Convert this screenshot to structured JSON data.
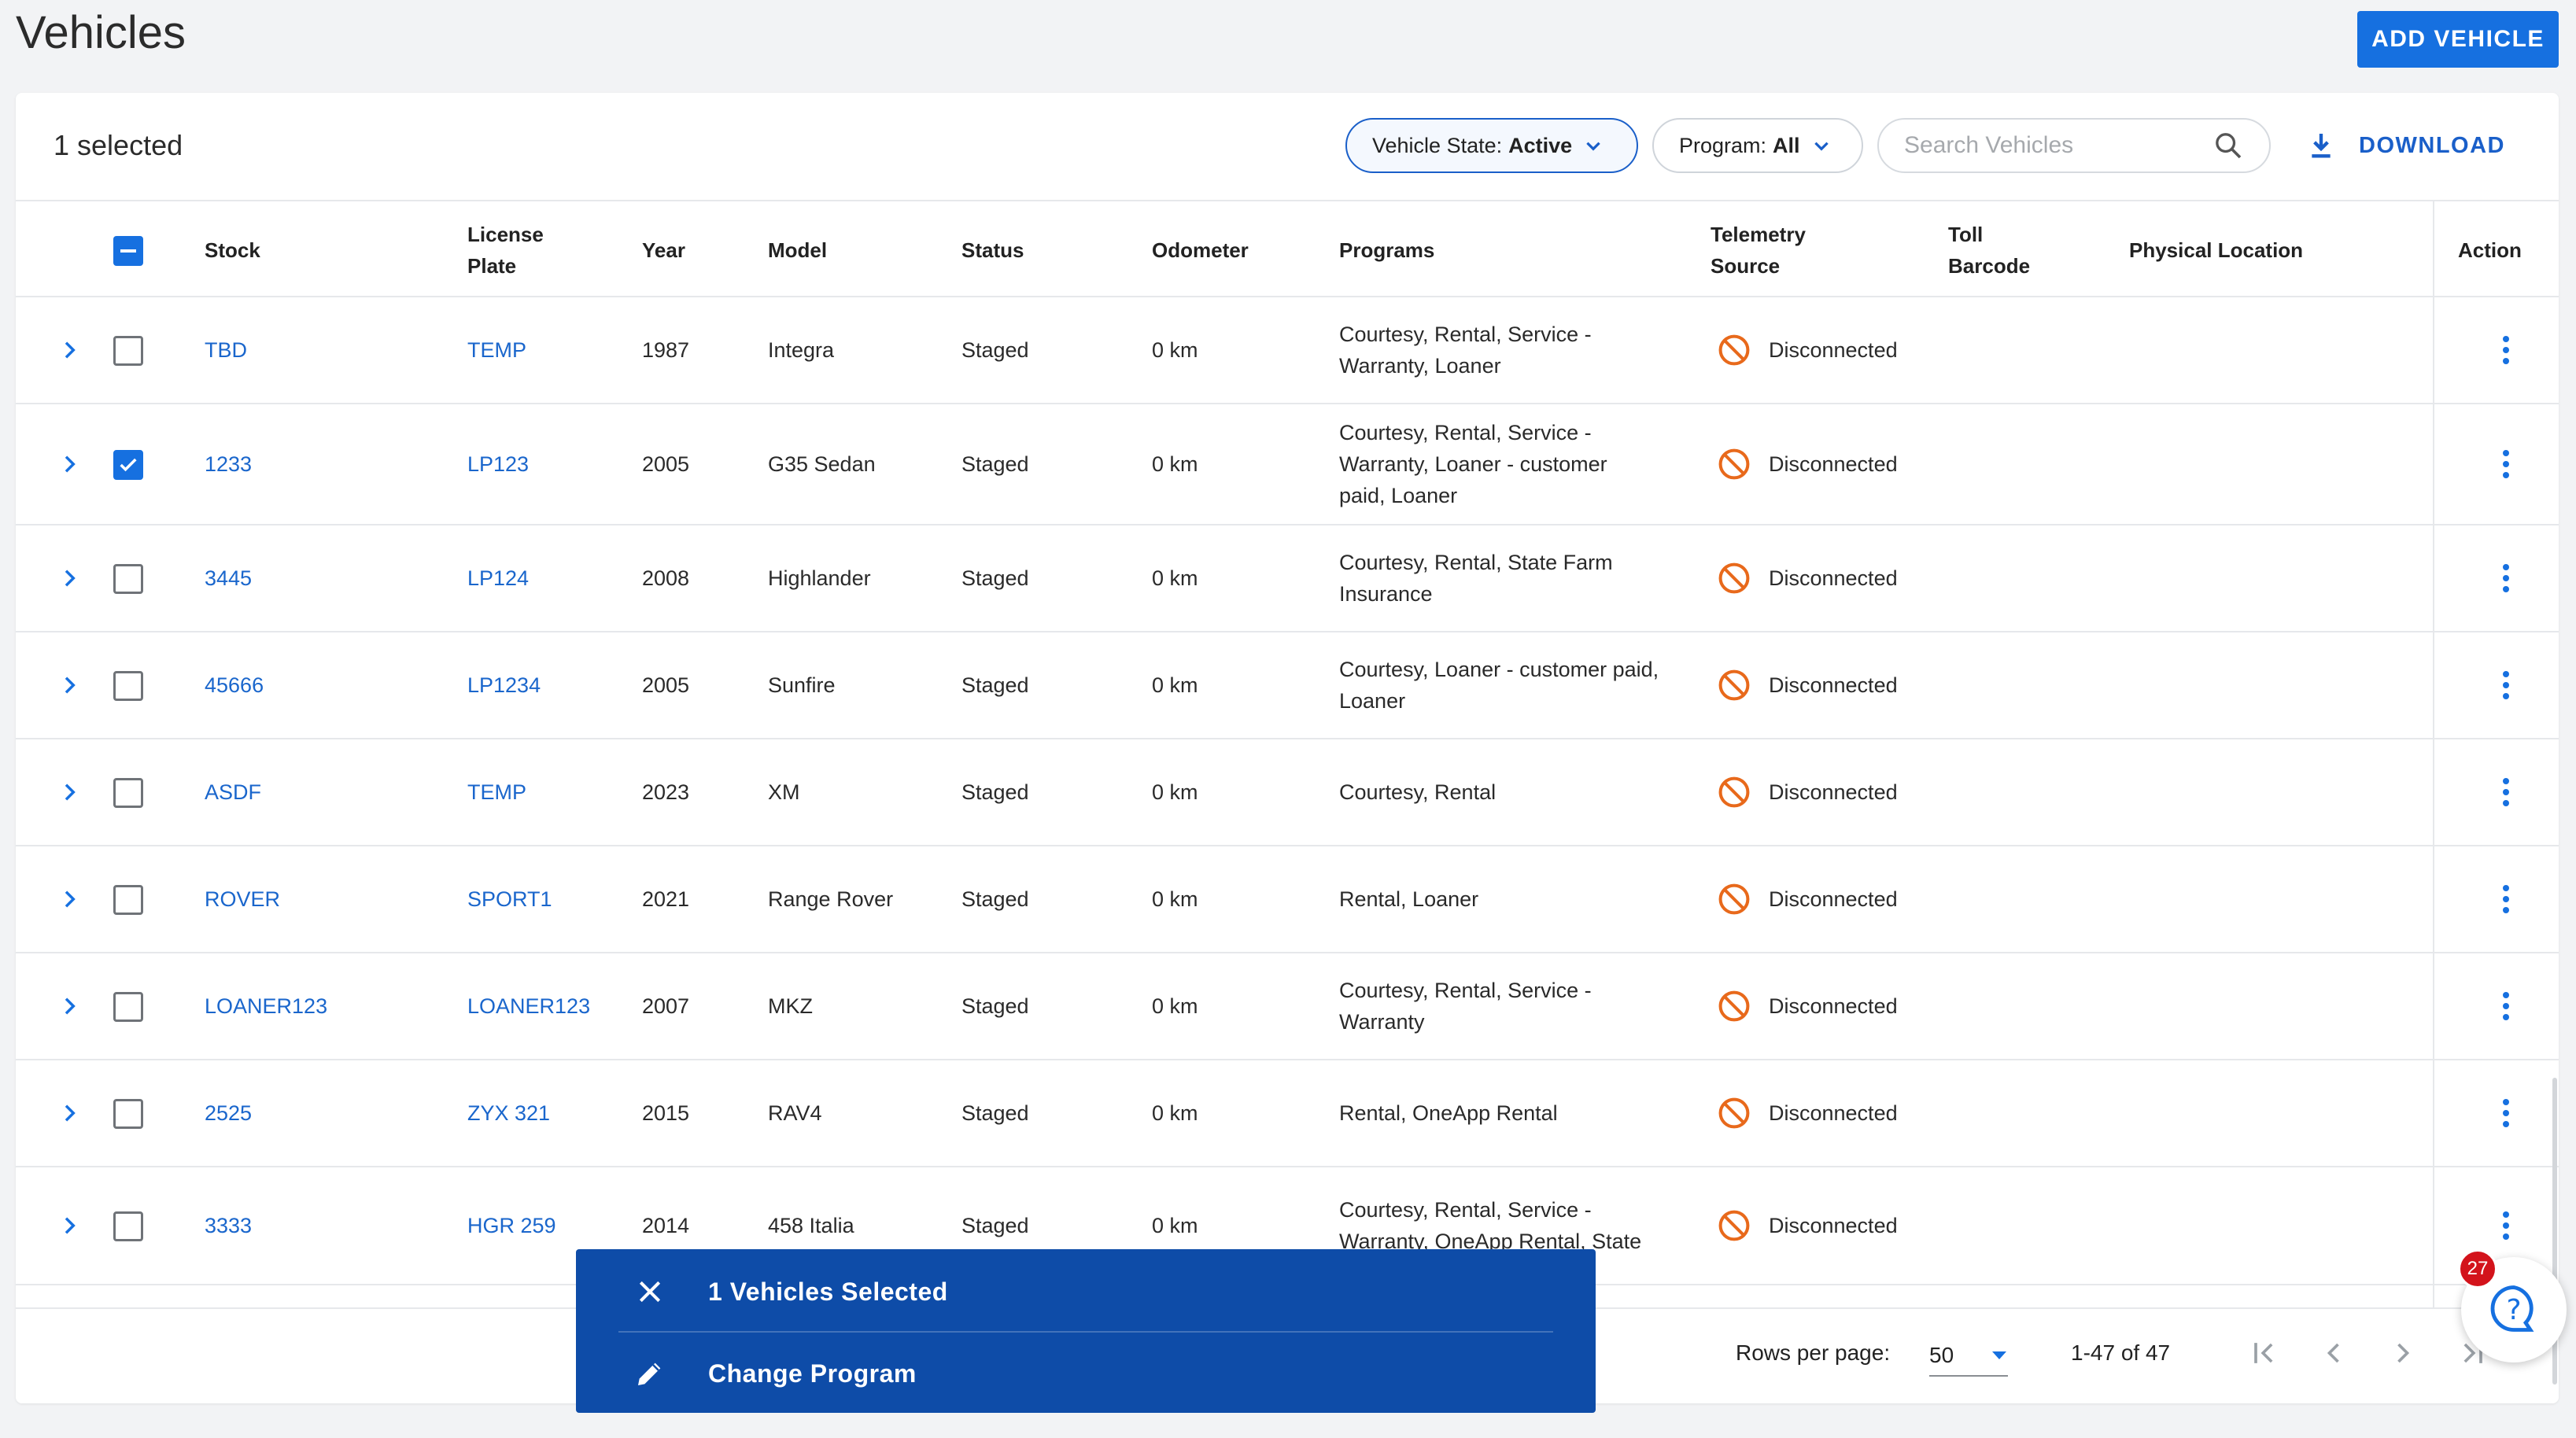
{
  "page": {
    "title": "Vehicles",
    "add_button": "ADD VEHICLE"
  },
  "toolbar": {
    "selected_count": "1 selected",
    "state_filter_label": "Vehicle State:",
    "state_filter_value": "Active",
    "program_filter_label": "Program:",
    "program_filter_value": "All",
    "search_placeholder": "Search Vehicles",
    "download_label": "DOWNLOAD"
  },
  "columns": {
    "stock": "Stock",
    "license_1": "License",
    "license_2": "Plate",
    "year": "Year",
    "model": "Model",
    "status": "Status",
    "odometer": "Odometer",
    "programs": "Programs",
    "telemetry_1": "Telemetry",
    "telemetry_2": "Source",
    "toll_1": "Toll",
    "toll_2": "Barcode",
    "location": "Physical Location",
    "action": "Action"
  },
  "rows": [
    {
      "stock": "TBD",
      "plate": "TEMP",
      "year": "1987",
      "model": "Integra",
      "status": "Staged",
      "odometer": "0 km",
      "programs": [
        "Courtesy, Rental, Service -",
        "Warranty, Loaner"
      ],
      "telemetry": "Disconnected",
      "checked": false
    },
    {
      "stock": "1233",
      "plate": "LP123",
      "year": "2005",
      "model": "G35 Sedan",
      "status": "Staged",
      "odometer": "0 km",
      "programs": [
        "Courtesy, Rental, Service -",
        "Warranty, Loaner - customer",
        "paid, Loaner"
      ],
      "telemetry": "Disconnected",
      "checked": true
    },
    {
      "stock": "3445",
      "plate": "LP124",
      "year": "2008",
      "model": "Highlander",
      "status": "Staged",
      "odometer": "0 km",
      "programs": [
        "Courtesy, Rental, State Farm",
        "Insurance"
      ],
      "telemetry": "Disconnected",
      "checked": false
    },
    {
      "stock": "45666",
      "plate": "LP1234",
      "year": "2005",
      "model": "Sunfire",
      "status": "Staged",
      "odometer": "0 km",
      "programs": [
        "Courtesy, Loaner - customer paid,",
        "Loaner"
      ],
      "telemetry": "Disconnected",
      "checked": false
    },
    {
      "stock": "ASDF",
      "plate": "TEMP",
      "year": "2023",
      "model": "XM",
      "status": "Staged",
      "odometer": "0 km",
      "programs": [
        "Courtesy, Rental"
      ],
      "telemetry": "Disconnected",
      "checked": false
    },
    {
      "stock": "ROVER",
      "plate": "SPORT1",
      "year": "2021",
      "model": "Range Rover",
      "status": "Staged",
      "odometer": "0 km",
      "programs": [
        "Rental, Loaner"
      ],
      "telemetry": "Disconnected",
      "checked": false
    },
    {
      "stock": "LOANER123",
      "plate": "LOANER123",
      "year": "2007",
      "model": "MKZ",
      "status": "Staged",
      "odometer": "0 km",
      "programs": [
        "Courtesy, Rental, Service -",
        "Warranty"
      ],
      "telemetry": "Disconnected",
      "checked": false
    },
    {
      "stock": "2525",
      "plate": "ZYX 321",
      "year": "2015",
      "model": "RAV4",
      "status": "Staged",
      "odometer": "0 km",
      "programs": [
        "Rental, OneApp Rental"
      ],
      "telemetry": "Disconnected",
      "checked": false
    },
    {
      "stock": "3333",
      "plate": "HGR 259",
      "year": "2014",
      "model": "458 Italia",
      "status": "Staged",
      "odometer": "0 km",
      "programs": [
        "Courtesy, Rental, Service -",
        "Warranty, OneApp Rental, State"
      ],
      "telemetry": "Disconnected",
      "checked": false
    }
  ],
  "pagination": {
    "rows_per_page_label": "Rows per page:",
    "rows_per_page_value": "50",
    "range": "1-47 of 47"
  },
  "snackbar": {
    "selected_label": "1 Vehicles Selected",
    "action_label": "Change Program"
  },
  "help": {
    "badge_count": "27"
  },
  "colors": {
    "accent": "#1670e0",
    "link": "#1a66cc",
    "snackbar": "#0e4ca8",
    "disconnected_icon": "#e8691b",
    "badge": "#d3131b"
  }
}
